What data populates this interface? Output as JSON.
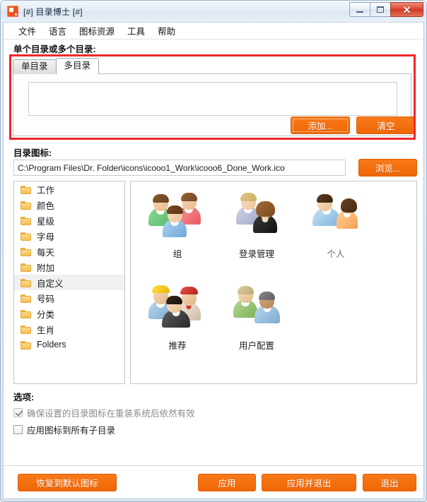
{
  "window": {
    "title": "[#] 目录博士 [#]",
    "app_icon": "app-folder-icon",
    "minimize": "–",
    "maximize": "□",
    "close": "✕",
    "accent_orange": "#f4700f",
    "annotation_red": "#f0262a"
  },
  "menubar": {
    "items": [
      {
        "label": "文件"
      },
      {
        "label": "语言"
      },
      {
        "label": "图标资源"
      },
      {
        "label": "工具"
      },
      {
        "label": "帮助"
      }
    ]
  },
  "directory_section": {
    "label": "单个目录或多个目录:",
    "tabs": [
      {
        "label": "单目录",
        "active": false
      },
      {
        "label": "多目录",
        "active": true
      }
    ],
    "textarea_value": "",
    "textarea_placeholder": "",
    "add_button": "添加...",
    "clear_button": "清空"
  },
  "icon_section": {
    "label": "目录图标:",
    "path_value": "C:\\Program Files\\Dr. Folder\\icons\\icooo1_Work\\icooo6_Done_Work.ico",
    "path_placeholder": "",
    "browse_button": "浏览..."
  },
  "tree": {
    "items": [
      {
        "label": "工作",
        "selected": false
      },
      {
        "label": "颜色",
        "selected": false
      },
      {
        "label": "星级",
        "selected": false
      },
      {
        "label": "字母",
        "selected": false
      },
      {
        "label": "每天",
        "selected": false
      },
      {
        "label": "附加",
        "selected": false
      },
      {
        "label": "自定义",
        "selected": true
      },
      {
        "label": "号码",
        "selected": false
      },
      {
        "label": "分类",
        "selected": false
      },
      {
        "label": "生肖",
        "selected": false
      },
      {
        "label": "Folders",
        "selected": false
      }
    ]
  },
  "icon_grid": {
    "rows": [
      [
        {
          "label": "组",
          "art": "three-people"
        },
        {
          "label": "登录管理",
          "art": "man-woman-dark"
        },
        {
          "label": "个人",
          "art": "couple-blue-orange"
        }
      ],
      [
        {
          "label": "推荐",
          "art": "workers-group"
        },
        {
          "label": "用户配置",
          "art": "two-users-green-blue"
        }
      ]
    ]
  },
  "options": {
    "label": "选项:",
    "items": [
      {
        "label": "确保设置的目录图标在重装系统后依然有效",
        "checked": true,
        "disabled": true
      },
      {
        "label": "应用图标到所有子目录",
        "checked": false,
        "disabled": false
      }
    ]
  },
  "footer": {
    "restore_button": "恢复到默认图标",
    "apply_button": "应用",
    "apply_exit_button": "应用并退出",
    "exit_button": "退出"
  }
}
